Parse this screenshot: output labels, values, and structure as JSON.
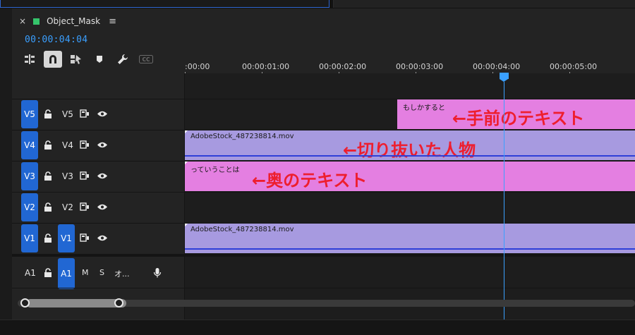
{
  "sequence": {
    "close_glyph": "×",
    "name": "Object_Mask",
    "menu_glyph": "≡",
    "color": "#35c46b",
    "timecode": "00:00:04:04"
  },
  "toolbar": {
    "icons": [
      "insert-sequence-icon",
      "snap-icon",
      "linked-selection-icon",
      "add-marker-icon",
      "wrench-icon",
      "captions-icon"
    ],
    "captions_label": "CC"
  },
  "ruler": {
    "labels": [
      ":00:00",
      "00:00:01:00",
      "00:00:02:00",
      "00:00:03:00",
      "00:00:04:00",
      "00:00:05:00"
    ]
  },
  "tracks": [
    {
      "target": "V5",
      "name": "V5"
    },
    {
      "target": "V4",
      "name": "V4"
    },
    {
      "target": "V3",
      "name": "V3"
    },
    {
      "target": "V2",
      "name": "V2"
    },
    {
      "target": "V1",
      "source": "V1",
      "name": "V1"
    },
    {
      "target": "A1",
      "source": "A1",
      "name": "A1",
      "mute": "M",
      "solo": "S",
      "label": "オ..."
    }
  ],
  "clips": {
    "v5": {
      "label": "もしかすると",
      "annotation": "←手前のテキスト"
    },
    "v4": {
      "label": "AdobeStock_487238814.mov",
      "annotation": "←切り抜いた人物"
    },
    "v3": {
      "label": "っていうことは",
      "annotation": "←奥のテキスト"
    },
    "v1": {
      "label": "AdobeStock_487238814.mov"
    }
  },
  "colors": {
    "accent_blue": "#2167d3",
    "timecode_blue": "#3a9fff",
    "text_clip": "#e47fe1",
    "video_clip": "#a79ae0",
    "annotation_red": "#ee1e2e",
    "work_area_yellow": "#ece64a"
  }
}
